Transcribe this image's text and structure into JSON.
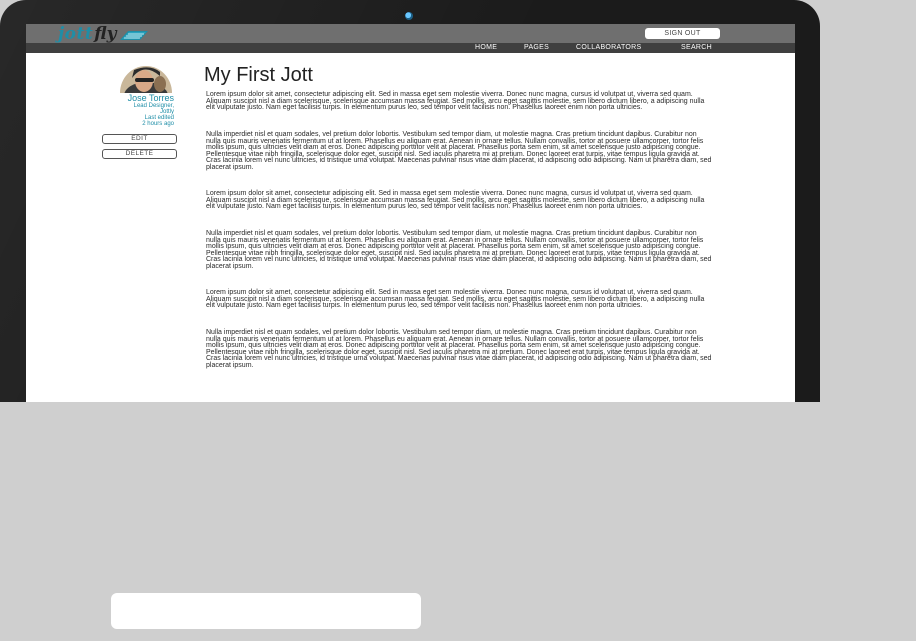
{
  "app": {
    "logo_text_part1": "jott",
    "logo_text_part2": "fly"
  },
  "header": {
    "sign_out_label": "SIGN OUT",
    "nav": [
      "HOME",
      "PAGES",
      "COLLABORATORS",
      "SEARCH"
    ]
  },
  "author": {
    "name": "Jose Torres",
    "role": "Lead Designer,",
    "company": "Jottly",
    "last_edited_label": "Last edited",
    "last_edited_value": "2 hours ago"
  },
  "actions": {
    "edit_label": "EDIT",
    "delete_label": "DELETE"
  },
  "page": {
    "title": "My First Jott",
    "paragraphs": [
      "Lorem ipsum dolor sit amet, consectetur adipiscing elit. Sed in massa eget sem molestie viverra. Donec nunc magna, cursus id volutpat ut, viverra sed quam. Aliquam suscipit nisl a diam scelerisque, scelerisque accumsan massa feugiat. Sed mollis, arcu eget sagittis molestie, sem libero dictum libero, a adipiscing nulla elit vulputate justo. Nam eget facilisis turpis. In elementum purus leo, sed tempor velit facilisis non. Phasellus laoreet enim non porta ultricies.",
      "Nulla imperdiet nisl et quam sodales, vel pretium dolor lobortis. Vestibulum sed tempor diam, ut molestie magna. Cras pretium tincidunt dapibus. Curabitur non nulla quis mauris venenatis fermentum ut at lorem. Phasellus eu aliquam erat. Aenean in ornare tellus. Nullam convallis, tortor at posuere ullamcorper, tortor felis mollis ipsum, quis ultricies velit diam at eros. Donec adipiscing porttitor velit at placerat. Phasellus porta sem enim, sit amet scelerisque justo adipiscing congue. Pellentesque vitae nibh fringilla, scelerisque dolor eget, suscipit nisl. Sed iaculis pharetra mi at pretium. Donec laoreet erat turpis, vitae tempus ligula gravida at. Cras lacinia lorem vel nunc ultricies, id tristique urna volutpat. Maecenas pulvinar risus vitae diam placerat, id adipiscing odio adipiscing. Nam ut pharetra diam, sed placerat ipsum.",
      "Lorem ipsum dolor sit amet, consectetur adipiscing elit. Sed in massa eget sem molestie viverra. Donec nunc magna, cursus id volutpat ut, viverra sed quam. Aliquam suscipit nisl a diam scelerisque, scelerisque accumsan massa feugiat. Sed mollis, arcu eget sagittis molestie, sem libero dictum libero, a adipiscing nulla elit vulputate justo. Nam eget facilisis turpis. In elementum purus leo, sed tempor velit facilisis non. Phasellus laoreet enim non porta ultricies.",
      "Nulla imperdiet nisl et quam sodales, vel pretium dolor lobortis. Vestibulum sed tempor diam, ut molestie magna. Cras pretium tincidunt dapibus. Curabitur non nulla quis mauris venenatis fermentum ut at lorem. Phasellus eu aliquam erat. Aenean in ornare tellus. Nullam convallis, tortor at posuere ullamcorper, tortor felis mollis ipsum, quis ultricies velit diam at eros. Donec adipiscing porttitor velit at placerat. Phasellus porta sem enim, sit amet scelerisque justo adipiscing congue. Pellentesque vitae nibh fringilla, scelerisque dolor eget, suscipit nisl. Sed iaculis pharetra mi at pretium. Donec laoreet erat turpis, vitae tempus ligula gravida at. Cras lacinia lorem vel nunc ultricies, id tristique urna volutpat. Maecenas pulvinar risus vitae diam placerat, id adipiscing odio adipiscing. Nam ut pharetra diam, sed placerat ipsum.",
      "Lorem ipsum dolor sit amet, consectetur adipiscing elit. Sed in massa eget sem molestie viverra. Donec nunc magna, cursus id volutpat ut, viverra sed quam. Aliquam suscipit nisl a diam scelerisque, scelerisque accumsan massa feugiat. Sed mollis, arcu eget sagittis molestie, sem libero dictum libero, a adipiscing nulla elit vulputate justo. Nam eget facilisis turpis. In elementum purus leo, sed tempor velit facilisis non. Phasellus laoreet enim non porta ultricies.",
      "Nulla imperdiet nisl et quam sodales, vel pretium dolor lobortis. Vestibulum sed tempor diam, ut molestie magna. Cras pretium tincidunt dapibus. Curabitur non nulla quis mauris venenatis fermentum ut at lorem. Phasellus eu aliquam erat. Aenean in ornare tellus. Nullam convallis, tortor at posuere ullamcorper, tortor felis mollis ipsum, quis ultricies velit diam at eros. Donec adipiscing porttitor velit at placerat. Phasellus porta sem enim, sit amet scelerisque justo adipiscing congue. Pellentesque vitae nibh fringilla, scelerisque dolor eget, suscipit nisl. Sed iaculis pharetra mi at pretium. Donec laoreet erat turpis, vitae tempus ligula gravida at. Cras lacinia lorem vel nunc ultricies, id tristique urna volutpat. Maecenas pulvinar risus vitae diam placerat, id adipiscing odio adipiscing. Nam ut pharetra diam, sed placerat ipsum."
    ]
  },
  "colors": {
    "brand_teal": "#1f8ea7",
    "top_bar": "#6f6f6f",
    "nav_bar": "#3f3f3f",
    "laptop_bezel": "#1b1b1b",
    "page_background": "#cfcfcf"
  }
}
